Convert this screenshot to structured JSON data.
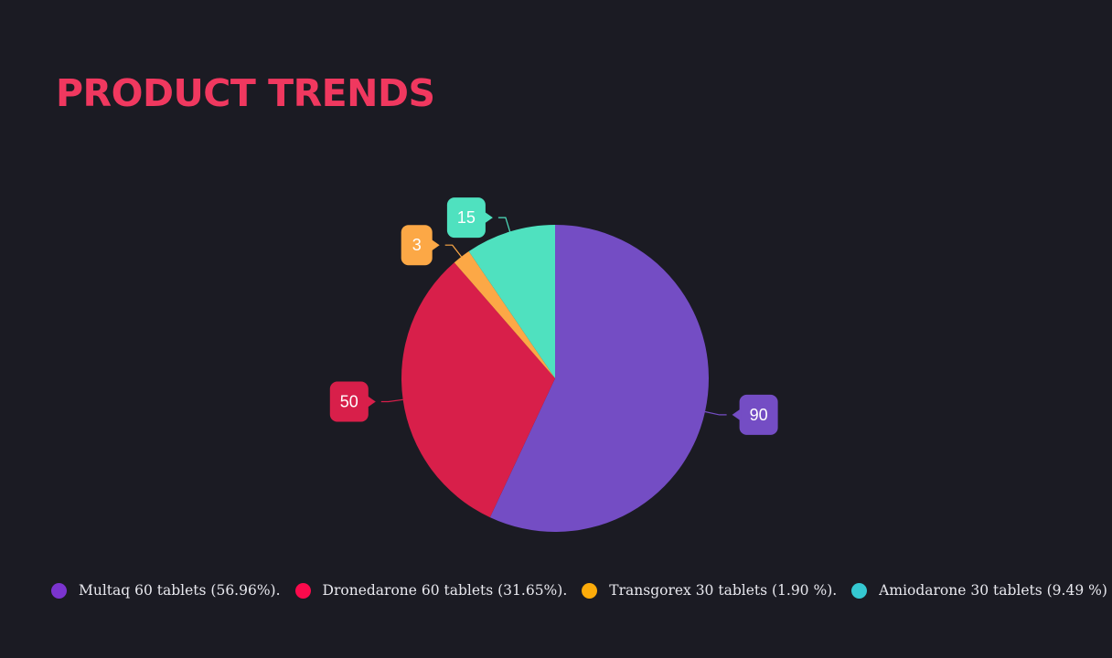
{
  "title": "PRODUCT TRENDS",
  "chart_data": {
    "type": "pie",
    "title": "PRODUCT TRENDS",
    "start_angle_deg": 0,
    "slices": [
      {
        "label": "Multaq 60 tablets (56.96%).",
        "value": 90,
        "color": "#744dc4"
      },
      {
        "label": "Dronedarone 60 tablets (31.65%).",
        "value": 50,
        "color": "#d81f4a"
      },
      {
        "label": "Transgorex 30 tablets (1.90 %).",
        "value": 3,
        "color": "#fca846"
      },
      {
        "label": "Amiodarone 30 tablets (9.49 %)",
        "value": 15,
        "color": "#4fe1bf"
      }
    ],
    "legend_colors": [
      "#7b34cf",
      "#fb0a4c",
      "#fcab0a",
      "#35c8d1"
    ],
    "data_labels": "callout",
    "legend_position": "bottom"
  }
}
